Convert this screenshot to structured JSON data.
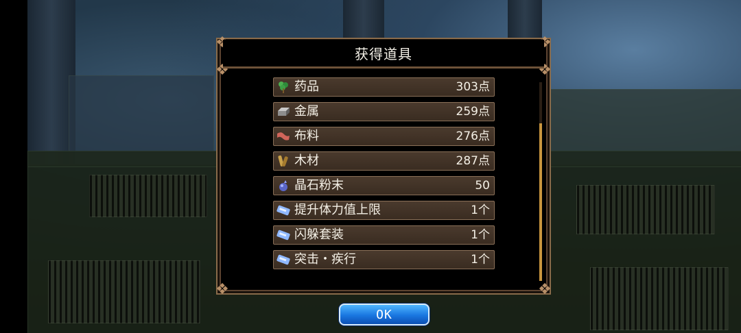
{
  "dialog": {
    "title": "获得道具",
    "ok_label": "OK"
  },
  "items": [
    {
      "icon": "herb-icon",
      "name": "药品",
      "qty": "303点"
    },
    {
      "icon": "metal-ingot-icon",
      "name": "金属",
      "qty": "259点"
    },
    {
      "icon": "cloth-icon",
      "name": "布料",
      "qty": "276点"
    },
    {
      "icon": "wood-icon",
      "name": "木材",
      "qty": "287点"
    },
    {
      "icon": "crystal-powder-icon",
      "name": "晶石粉末",
      "qty": "50"
    },
    {
      "icon": "ticket-icon",
      "name": "提升体力值上限",
      "qty": "1个"
    },
    {
      "icon": "ticket-icon",
      "name": "闪躲套装",
      "qty": "1个"
    },
    {
      "icon": "ticket-icon",
      "name": "突击・疾行",
      "qty": "1个"
    }
  ],
  "colors": {
    "frame": "#8a6b4a",
    "row_bg": "#4a3a2d",
    "scroll_thumb": "#c9963f",
    "ok_button": "#1976e0"
  }
}
